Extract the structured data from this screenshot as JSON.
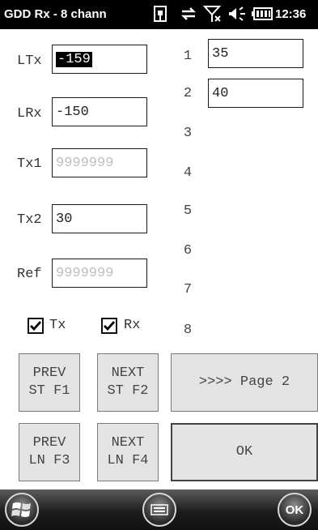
{
  "statusbar": {
    "title": "GDD Rx - 8 chann",
    "clock": "12:36",
    "icons": [
      "sim-icon",
      "sync-arrows-icon",
      "no-signal-icon",
      "volume-icon",
      "battery-icon"
    ]
  },
  "left": {
    "ltx_label": "LTx",
    "ltx_value": "-159",
    "lrx_label": "LRx",
    "lrx_value": "-150",
    "tx1_label": "Tx1",
    "tx1_placeholder": "9999999",
    "tx2_label": "Tx2",
    "tx2_value": "30",
    "ref_label": "Ref",
    "ref_placeholder": "9999999",
    "tx_check_label": "Tx",
    "tx_checked": true,
    "rx_check_label": "Rx",
    "rx_checked": true
  },
  "channels": [
    {
      "num": "1",
      "value": "35"
    },
    {
      "num": "2",
      "value": "40"
    },
    {
      "num": "3",
      "value": ""
    },
    {
      "num": "4",
      "value": ""
    },
    {
      "num": "5",
      "value": ""
    },
    {
      "num": "6",
      "value": ""
    },
    {
      "num": "7",
      "value": ""
    },
    {
      "num": "8",
      "value": ""
    }
  ],
  "buttons": {
    "prev_st": "PREV\nST F1",
    "next_st": "NEXT\nST F2",
    "page": ">>>> Page 2",
    "prev_ln": "PREV\nLN F3",
    "next_ln": "NEXT\nLN F4",
    "ok": "OK"
  },
  "taskbar": {
    "ok_label": "OK"
  }
}
